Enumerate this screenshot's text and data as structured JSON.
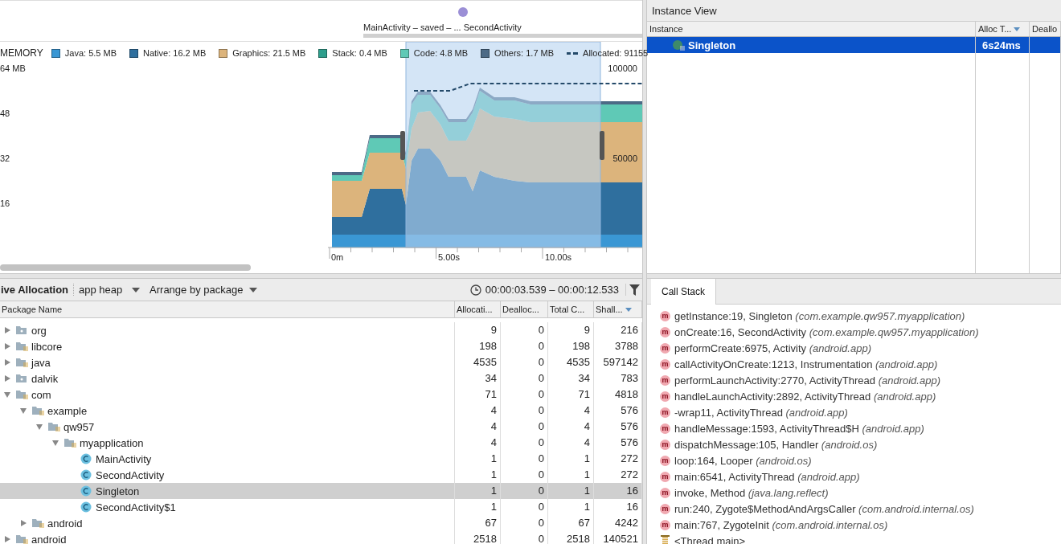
{
  "timeline": {
    "event_label": "MainActivity – saved – ... SecondActivity"
  },
  "memory_chart": {
    "title": "MEMORY",
    "legend": [
      {
        "kind": "swatch",
        "label": "Java: 5.5 MB",
        "color": "#3a97d4"
      },
      {
        "kind": "swatch",
        "label": "Native: 16.2 MB",
        "color": "#2f6f9e"
      },
      {
        "kind": "swatch",
        "label": "Graphics: 21.5 MB",
        "color": "#dcb47c"
      },
      {
        "kind": "swatch",
        "label": "Stack: 0.4 MB",
        "color": "#2e9e8c"
      },
      {
        "kind": "swatch",
        "label": "Code: 4.8 MB",
        "color": "#5fc9b6"
      },
      {
        "kind": "swatch",
        "label": "Others: 1.7 MB",
        "color": "#4c6a86"
      },
      {
        "kind": "dashed",
        "label": "Allocated: 91155",
        "color": "#244a6a"
      }
    ],
    "left_axis_labels": [
      "64 MB",
      "48",
      "32",
      "16"
    ],
    "right_axis_labels": [
      "100000",
      "50000"
    ],
    "time_labels": [
      "0m",
      "5.00s",
      "10.00s"
    ]
  },
  "allocation_toolbar": {
    "title": "ive Allocation",
    "heap": "app heap",
    "arrangement": "Arrange by package",
    "time_range": "00:00:03.539 – 00:00:12.533"
  },
  "package_table": {
    "columns": [
      "Package Name",
      "Allocati...",
      "Dealloc...",
      "Total C...",
      "Shall..."
    ],
    "rows": [
      {
        "kind": "folder",
        "name": "org",
        "expanded": false,
        "selected": false,
        "cells": [
          "9",
          "0",
          "9",
          "216"
        ]
      },
      {
        "kind": "package",
        "name": "libcore",
        "expanded": false,
        "selected": false,
        "cells": [
          "198",
          "0",
          "198",
          "3788"
        ]
      },
      {
        "kind": "package",
        "name": "java",
        "expanded": false,
        "selected": false,
        "cells": [
          "4535",
          "0",
          "4535",
          "597142"
        ]
      },
      {
        "kind": "folder",
        "name": "dalvik",
        "expanded": false,
        "selected": false,
        "cells": [
          "34",
          "0",
          "34",
          "783"
        ]
      },
      {
        "kind": "package",
        "name": "com",
        "expanded": true,
        "selected": false,
        "cells": [
          "71",
          "0",
          "71",
          "4818"
        ],
        "children": [
          {
            "kind": "package",
            "name": "example",
            "expanded": true,
            "selected": false,
            "cells": [
              "4",
              "0",
              "4",
              "576"
            ],
            "children": [
              {
                "kind": "package",
                "name": "qw957",
                "expanded": true,
                "selected": false,
                "cells": [
                  "4",
                  "0",
                  "4",
                  "576"
                ],
                "children": [
                  {
                    "kind": "package",
                    "name": "myapplication",
                    "expanded": true,
                    "selected": false,
                    "cells": [
                      "4",
                      "0",
                      "4",
                      "576"
                    ],
                    "children": [
                      {
                        "kind": "class",
                        "name": "MainActivity",
                        "selected": false,
                        "cells": [
                          "1",
                          "0",
                          "1",
                          "272"
                        ]
                      },
                      {
                        "kind": "class",
                        "name": "SecondActivity",
                        "selected": false,
                        "cells": [
                          "1",
                          "0",
                          "1",
                          "272"
                        ]
                      },
                      {
                        "kind": "class",
                        "name": "Singleton",
                        "selected": true,
                        "cells": [
                          "1",
                          "0",
                          "1",
                          "16"
                        ]
                      },
                      {
                        "kind": "class",
                        "name": "SecondActivity$1",
                        "selected": false,
                        "cells": [
                          "1",
                          "0",
                          "1",
                          "16"
                        ]
                      }
                    ]
                  }
                ]
              }
            ]
          },
          {
            "kind": "package",
            "name": "android",
            "expanded": false,
            "selected": false,
            "cells": [
              "67",
              "0",
              "67",
              "4242"
            ]
          }
        ]
      },
      {
        "kind": "package",
        "name": "android",
        "expanded": false,
        "selected": false,
        "cells": [
          "2518",
          "0",
          "2518",
          "140521"
        ]
      }
    ]
  },
  "instance_view": {
    "title": "Instance View",
    "columns": [
      "Instance",
      "Alloc T...",
      "Deallo"
    ],
    "rows": [
      {
        "name": "Singleton",
        "alloc_time": "6s24ms",
        "selected": true
      }
    ]
  },
  "call_stack": {
    "tab": "Call Stack",
    "frames": [
      {
        "kind": "method",
        "badge": "m",
        "method": "getInstance:19, Singleton",
        "package": "(com.example.qw957.myapplication)"
      },
      {
        "kind": "method",
        "badge": "m",
        "method": "onCreate:16, SecondActivity",
        "package": "(com.example.qw957.myapplication)"
      },
      {
        "kind": "method",
        "badge": "m",
        "method": "performCreate:6975, Activity",
        "package": "(android.app)"
      },
      {
        "kind": "method",
        "badge": "m",
        "method": "callActivityOnCreate:1213, Instrumentation",
        "package": "(android.app)"
      },
      {
        "kind": "method",
        "badge": "m",
        "method": "performLaunchActivity:2770, ActivityThread",
        "package": "(android.app)"
      },
      {
        "kind": "method",
        "badge": "m",
        "method": "handleLaunchActivity:2892, ActivityThread",
        "package": "(android.app)"
      },
      {
        "kind": "method",
        "badge": "m",
        "method": "-wrap11, ActivityThread",
        "package": "(android.app)"
      },
      {
        "kind": "method",
        "badge": "m",
        "method": "handleMessage:1593, ActivityThread$H",
        "package": "(android.app)"
      },
      {
        "kind": "method",
        "badge": "m",
        "method": "dispatchMessage:105, Handler",
        "package": "(android.os)"
      },
      {
        "kind": "method",
        "badge": "m",
        "method": "loop:164, Looper",
        "package": "(android.os)"
      },
      {
        "kind": "method",
        "badge": "m",
        "method": "main:6541, ActivityThread",
        "package": "(android.app)"
      },
      {
        "kind": "method",
        "badge": "m",
        "method": "invoke, Method",
        "package": "(java.lang.reflect)"
      },
      {
        "kind": "method",
        "badge": "m",
        "method": "run:240, Zygote$MethodAndArgsCaller",
        "package": "(com.android.internal.os)"
      },
      {
        "kind": "method",
        "badge": "m",
        "method": "main:767, ZygoteInit",
        "package": "(com.android.internal.os)"
      },
      {
        "kind": "thread",
        "method": "<Thread main>"
      }
    ]
  }
}
